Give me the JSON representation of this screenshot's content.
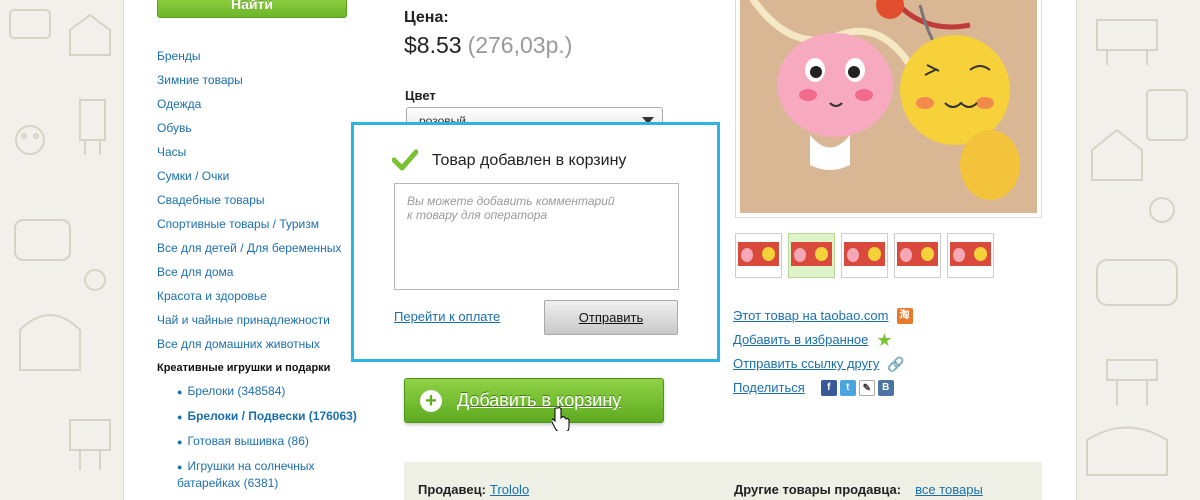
{
  "search": {
    "button_label": "Найти"
  },
  "sidebar": {
    "categories": [
      "Бренды",
      "Зимние товары",
      "Одежда",
      "Обувь",
      "Часы",
      "Сумки / Очки",
      "Свадебные товары",
      "Спортивные товары / Туризм",
      "Все для детей / Для беременных",
      "Все для дома",
      "Красота и здоровье",
      "Чай и чайные принадлежности",
      "Все для домашних животных",
      "Креативные игрушки и подарки"
    ],
    "subcategories": [
      "Брелоки (348584)",
      "Брелоки / Подвески (176063)",
      "Готовая вышивка (86)",
      "Игрушки на солнечных батарейках (6381)"
    ]
  },
  "product": {
    "price_label": "Цена:",
    "price_usd": "$8.53",
    "price_rub": "(276,03р.)",
    "color_label": "Цвет",
    "color_value": "розовый",
    "add_to_cart": "Добавить в корзину"
  },
  "modal": {
    "title": "Товар добавлен в корзину",
    "comment_placeholder": "Вы можете добавить комментарий\nк товару для оператора",
    "pay_link": "Перейти к оплате",
    "send_button": "Отправить"
  },
  "actions": {
    "taobao": "Этот товар на taobao.com",
    "favorite": "Добавить в избранное",
    "send_friend": "Отправить ссылку другу",
    "share": "Поделиться"
  },
  "seller": {
    "label": "Продавец:",
    "name": "Trololo",
    "other_label": "Другие товары продавца:",
    "all_link": "все товары"
  },
  "colors": {
    "accent_green": "#6cb52a",
    "modal_border": "#2bb4e6",
    "link": "#1b6fad"
  }
}
